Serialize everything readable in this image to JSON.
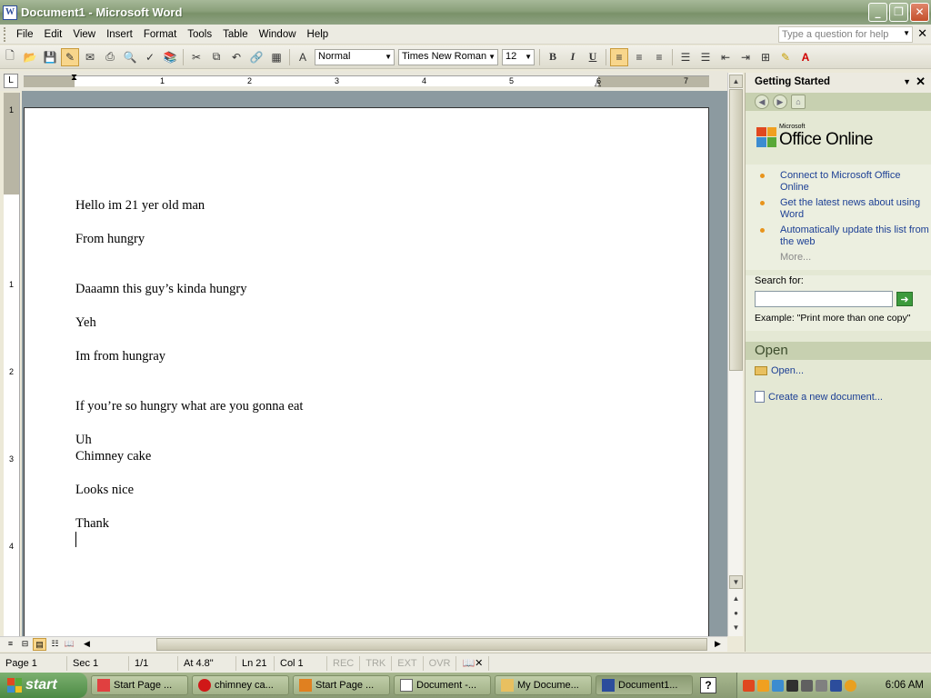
{
  "window": {
    "title": "Document1 - Microsoft Word"
  },
  "menu": {
    "items": [
      "File",
      "Edit",
      "View",
      "Insert",
      "Format",
      "Tools",
      "Table",
      "Window",
      "Help"
    ],
    "help_placeholder": "Type a question for help"
  },
  "toolbar": {
    "style": "Normal",
    "font": "Times New Roman",
    "size": "12",
    "bold": "B",
    "italic": "I",
    "underline": "U"
  },
  "ruler": {
    "numbers": [
      "1",
      "2",
      "3",
      "4",
      "5",
      "6",
      "7"
    ],
    "vnumbers": [
      "1",
      "1",
      "2",
      "3",
      "4"
    ]
  },
  "document": {
    "lines": {
      "l1": "Hello im 21 yer old man",
      "l2": "From hungry",
      "l3": "Daaamn this guy’s kinda hungry",
      "l4": "Yeh",
      "l5": "Im from hungray",
      "l6": "If you’re so hungry what are you gonna eat",
      "l7a": "Uh",
      "l7b": "Chimney cake",
      "l8": "Looks nice",
      "l9": "Thank"
    }
  },
  "taskpane": {
    "title": "Getting Started",
    "logo_small": "Microsoft",
    "logo_big": "Office Online",
    "links": [
      "Connect to Microsoft Office Online",
      "Get the latest news about using Word",
      "Automatically update this list from the web"
    ],
    "more": "More...",
    "search_label": "Search for:",
    "example": "Example:  \"Print more than one copy\"",
    "open_header": "Open",
    "open_link": "Open...",
    "new_link": "Create a new document..."
  },
  "status": {
    "page": "Page  1",
    "sec": "Sec  1",
    "pages": "1/1",
    "at": "At  4.8\"",
    "ln": "Ln  21",
    "col": "Col  1",
    "rec": "REC",
    "trk": "TRK",
    "ext": "EXT",
    "ovr": "OVR"
  },
  "taskbar": {
    "start": "start",
    "tasks": [
      "Start Page ...",
      "chimney ca...",
      "Start Page ...",
      "Document -...",
      "My Docume...",
      "Document1..."
    ],
    "clock": "6:06 AM"
  },
  "colors": {
    "accent": "#1c3f94",
    "title_bar": "#8aa07a",
    "squiggle": "#d00000"
  }
}
